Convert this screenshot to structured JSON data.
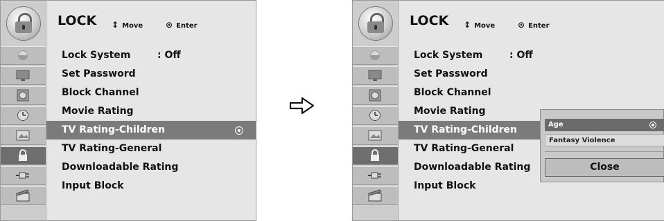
{
  "left": {
    "title": "LOCK",
    "hints": {
      "move_symbol": "↕",
      "move_label": "Move",
      "enter_symbol": "⊙",
      "enter_label": "Enter"
    },
    "sidebar_icons": [
      "satellite-icon",
      "monitor-icon",
      "speaker-icon",
      "clock-icon",
      "picture-icon",
      "lock-icon",
      "cable-icon",
      "clapper-icon"
    ],
    "menu": [
      {
        "label": "Lock System",
        "value": ": Off"
      },
      {
        "label": "Set Password"
      },
      {
        "label": "Block Channel"
      },
      {
        "label": "Movie Rating"
      },
      {
        "label": "TV Rating-Children",
        "selected": true
      },
      {
        "label": "TV Rating-General"
      },
      {
        "label": "Downloadable Rating"
      },
      {
        "label": "Input Block"
      }
    ]
  },
  "right": {
    "title": "LOCK",
    "hints": {
      "move_symbol": "↕",
      "move_label": "Move",
      "enter_symbol": "⊙",
      "enter_label": "Enter"
    },
    "menu": [
      {
        "label": "Lock System",
        "value": ": Off"
      },
      {
        "label": "Set Password"
      },
      {
        "label": "Block Channel"
      },
      {
        "label": "Movie Rating"
      },
      {
        "label": "TV Rating-Children",
        "selected": true
      },
      {
        "label": "TV Rating-General"
      },
      {
        "label": "Downloadable Rating"
      },
      {
        "label": "Input Block"
      }
    ],
    "popup": {
      "options": [
        "Age",
        "Fantasy Violence"
      ],
      "close_label": "Close"
    }
  },
  "transition_icon": "arrow-right-icon"
}
